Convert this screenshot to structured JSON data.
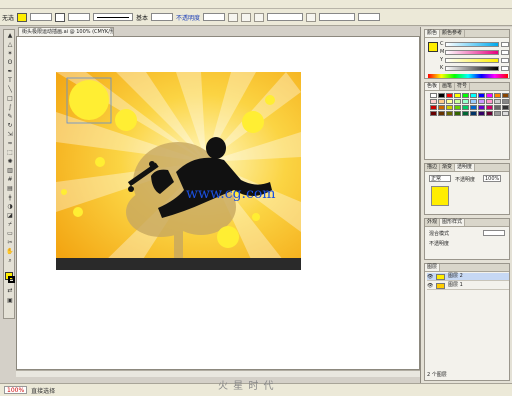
{
  "menubar": {
    "items": [
      "",
      "",
      "",
      "",
      "",
      "",
      "",
      "",
      ""
    ]
  },
  "controlbar": {
    "label": "无选",
    "fill_color": "#ffee00",
    "stroke_label": "",
    "style_label": "基本",
    "opacity_label": "不透明度",
    "style2_label": "样式"
  },
  "document_tab": {
    "title": "街头极限运动插画.ai @ 100% (CMYK/预览)"
  },
  "toolbox": {
    "tools": [
      "selection-tool",
      "direct-selection-tool",
      "magic-wand-tool",
      "lasso-tool",
      "pen-tool",
      "type-tool",
      "line-tool",
      "rectangle-tool",
      "paintbrush-tool",
      "pencil-tool",
      "rotate-tool",
      "scale-tool",
      "warp-tool",
      "free-transform-tool",
      "symbol-sprayer-tool",
      "graph-tool",
      "mesh-tool",
      "gradient-tool",
      "eyedropper-tool",
      "blend-tool",
      "live-paint-tool",
      "slice-tool",
      "eraser-tool",
      "scissors-tool",
      "hand-tool",
      "zoom-tool"
    ],
    "fill_color": "#ffee00",
    "stroke_color": "#000000"
  },
  "artwork": {
    "background_colors": [
      "#fff3a0",
      "#f9c22d",
      "#f3a512"
    ],
    "ground_color": "#2a2a2a",
    "silhouette_color": "#111111",
    "circle_color": "#ffee33",
    "tree_color": "#c8a860"
  },
  "watermark": "www.cg.com",
  "status": {
    "zoom": "100%",
    "tool_text": "直接选择"
  },
  "site_logo": "火 星 时 代",
  "panels": {
    "color": {
      "tabs": [
        "颜色",
        "颜色参考"
      ],
      "rows": [
        {
          "letter": "C",
          "value": "5"
        },
        {
          "letter": "M",
          "value": "0"
        },
        {
          "letter": "Y",
          "value": "90"
        },
        {
          "letter": "K",
          "value": "0"
        }
      ],
      "fill": "#ffee00"
    },
    "swatches": {
      "tabs": [
        "色板",
        "画笔",
        "符号"
      ],
      "colors": [
        "#ffffff",
        "#000000",
        "#ff0000",
        "#ffff00",
        "#00ff00",
        "#00ffff",
        "#0000ff",
        "#ff00ff",
        "#ff8800",
        "#884400",
        "#ffcccc",
        "#ffcc88",
        "#ffff99",
        "#ccff99",
        "#99ffcc",
        "#99ccff",
        "#cc99ff",
        "#ff99cc",
        "#cccccc",
        "#888888",
        "#cc0000",
        "#cc6600",
        "#cccc00",
        "#66cc00",
        "#00cc66",
        "#0066cc",
        "#6600cc",
        "#cc0066",
        "#666666",
        "#333333",
        "#660000",
        "#663300",
        "#666600",
        "#336600",
        "#006633",
        "#003366",
        "#330066",
        "#660033",
        "#999999",
        "#dddddd"
      ]
    },
    "stroke": {
      "tabs": [
        "描边",
        "渐变",
        "透明度"
      ],
      "mode": "正常",
      "opacity_label": "不透明度",
      "opacity": "100%",
      "swatch": "#ffee00"
    },
    "appearance": {
      "tabs": [
        "外观",
        "图形样式"
      ],
      "lines": [
        "混合模式",
        "不透明度"
      ]
    },
    "layers": {
      "tabs": [
        "图层"
      ],
      "items": [
        {
          "name": "图层 2",
          "color": "#ffee00"
        },
        {
          "name": "图层 1",
          "color": "#ffcc00"
        }
      ],
      "footer": "2 个图层"
    }
  }
}
